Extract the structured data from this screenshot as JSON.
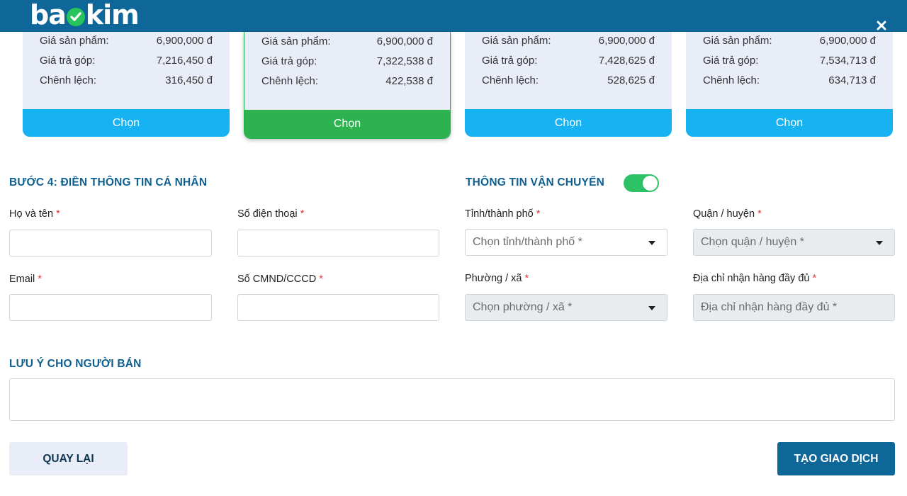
{
  "header": {
    "logo_prefix": "ba",
    "logo_suffix": "kim",
    "close_icon": "close-icon",
    "bar_color": "#0e6699"
  },
  "plans": [
    {
      "price_label": "Giá sản phẩm:",
      "price": "6,900,000 đ",
      "installment_label": "Giá trả góp:",
      "installment": "7,216,450 đ",
      "diff_label": "Chênh lệch:",
      "diff": "316,450 đ",
      "button": "Chọn",
      "selected": false
    },
    {
      "price_label": "Giá sản phẩm:",
      "price": "6,900,000 đ",
      "installment_label": "Giá trả góp:",
      "installment": "7,322,538 đ",
      "diff_label": "Chênh lệch:",
      "diff": "422,538 đ",
      "button": "Chọn",
      "selected": true
    },
    {
      "price_label": "Giá sản phẩm:",
      "price": "6,900,000 đ",
      "installment_label": "Giá trả góp:",
      "installment": "7,428,625 đ",
      "diff_label": "Chênh lệch:",
      "diff": "528,625 đ",
      "button": "Chọn",
      "selected": false
    },
    {
      "price_label": "Giá sản phẩm:",
      "price": "6,900,000 đ",
      "installment_label": "Giá trả góp:",
      "installment": "7,534,713 đ",
      "diff_label": "Chênh lệch:",
      "diff": "634,713 đ",
      "button": "Chọn",
      "selected": false
    }
  ],
  "personal": {
    "title": "BƯỚC 4: ĐIỀN THÔNG TIN CÁ NHÂN",
    "name_label": "Họ và tên",
    "phone_label": "Số điện thoại",
    "email_label": "Email",
    "id_label": "Số CMND/CCCD",
    "required_mark": "*",
    "name_value": "",
    "phone_value": "",
    "email_value": "",
    "id_value": ""
  },
  "shipping": {
    "title": "THÔNG TIN VẬN CHUYỂN",
    "toggle_on": true,
    "province_label": "Tỉnh/thành phố",
    "province_placeholder": "Chọn tỉnh/thành phố *",
    "district_label": "Quận / huyện",
    "district_placeholder": "Chọn quận / huyện *",
    "ward_label": "Phường / xã",
    "ward_placeholder": "Chọn phường / xã *",
    "address_label": "Địa chỉ nhận hàng đầy đủ",
    "address_placeholder": "Địa chỉ nhận hàng đầy đủ *",
    "required_mark": "*"
  },
  "note": {
    "title": "LƯU Ý CHO NGƯỜI BÁN",
    "value": ""
  },
  "actions": {
    "back_label": "QUAY LẠI",
    "submit_label": "TẠO GIAO DỊCH"
  }
}
